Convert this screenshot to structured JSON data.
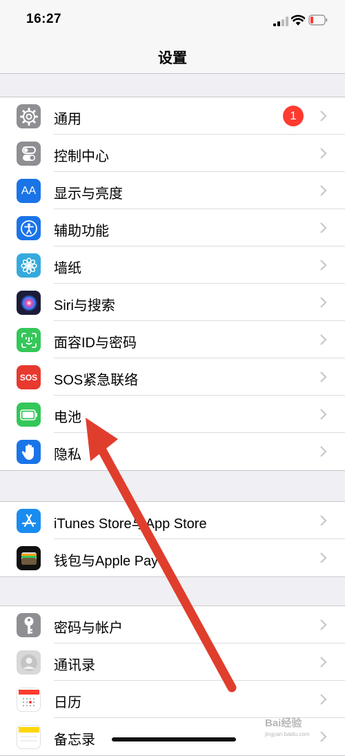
{
  "status_bar": {
    "time": "16:27"
  },
  "nav": {
    "title": "设置"
  },
  "colors": {
    "badge": "#ff3b30",
    "arrow": "#e03e2d",
    "chevron": "#c7c7cc"
  },
  "groups": [
    {
      "rows": [
        {
          "label": "通用",
          "icon": "gear-icon",
          "color": "#8e8e93",
          "badge": "1"
        },
        {
          "label": "控制中心",
          "icon": "toggles-icon",
          "color": "#8e8e93"
        },
        {
          "label": "显示与亮度",
          "icon": "text-size-icon",
          "color": "#1a74e8",
          "icon_text": "AA"
        },
        {
          "label": "辅助功能",
          "icon": "accessibility-icon",
          "color": "#1a74e8"
        },
        {
          "label": "墙纸",
          "icon": "flower-icon",
          "color": "#36aadc"
        },
        {
          "label": "Siri与搜索",
          "icon": "siri-icon",
          "color": "#1c1c3a"
        },
        {
          "label": "面容ID与密码",
          "icon": "face-id-icon",
          "color": "#34c759"
        },
        {
          "label": "SOS紧急联络",
          "icon": "sos-icon",
          "color": "#e8392f",
          "icon_text": "SOS"
        },
        {
          "label": "电池",
          "icon": "battery-icon",
          "color": "#34c759"
        },
        {
          "label": "隐私",
          "icon": "hand-icon",
          "color": "#1a74e8"
        }
      ]
    },
    {
      "rows": [
        {
          "label": "iTunes Store与App Store",
          "icon": "app-store-icon",
          "color": "#1a8cf0"
        },
        {
          "label": "钱包与Apple Pay",
          "icon": "wallet-icon",
          "color": "#111111"
        }
      ]
    },
    {
      "rows": [
        {
          "label": "密码与帐户",
          "icon": "key-icon",
          "color": "#8e8e93"
        },
        {
          "label": "通讯录",
          "icon": "contacts-icon",
          "color": "#d8d8d8"
        },
        {
          "label": "日历",
          "icon": "calendar-icon",
          "color": "#ffffff"
        },
        {
          "label": "备忘录",
          "icon": "notes-icon",
          "color": "#ffd60a"
        }
      ]
    }
  ],
  "watermark": {
    "text": "Bai经验",
    "sub": "jingyan.baidu.com"
  }
}
